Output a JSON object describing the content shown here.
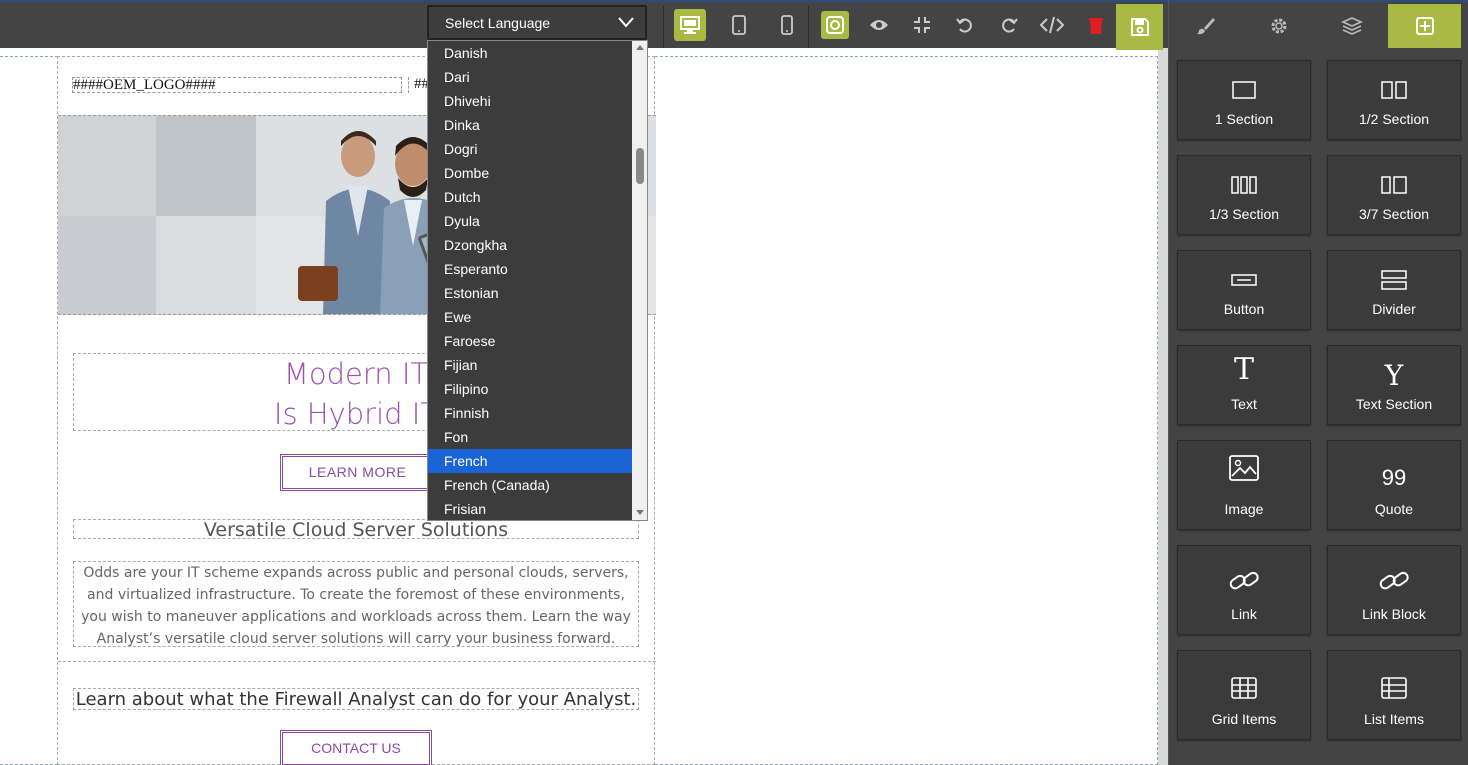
{
  "toolbar": {
    "language_select": "Select Language",
    "icons": [
      "desktop-icon",
      "tablet-icon",
      "mobile-icon",
      "outline-icon",
      "preview-icon",
      "fullscreen-exit-icon",
      "undo-icon",
      "redo-icon",
      "code-icon",
      "trash-icon",
      "save-icon"
    ]
  },
  "panel": {
    "tabs": [
      "brush-icon",
      "gear-icon",
      "layers-icon",
      "add-block-icon"
    ],
    "blocks": [
      {
        "label": "1 Section"
      },
      {
        "label": "1/2 Section"
      },
      {
        "label": "1/3 Section"
      },
      {
        "label": "3/7 Section"
      },
      {
        "label": "Button"
      },
      {
        "label": "Divider"
      },
      {
        "label": "Text"
      },
      {
        "label": "Text Section"
      },
      {
        "label": "Image"
      },
      {
        "label": "Quote"
      },
      {
        "label": "Link"
      },
      {
        "label": "Link Block"
      },
      {
        "label": "Grid Items"
      },
      {
        "label": "List Items"
      }
    ]
  },
  "email": {
    "logo": "####OEM_LOGO####",
    "logo2": "##",
    "headline_line1": "Modern IT",
    "headline_line2": "Is Hybrid IT",
    "learn_more": "LEARN MORE",
    "subhead": "Versatile Cloud Server Solutions",
    "paragraph": "Odds are your IT scheme expands across public and personal clouds, servers, and virtualized infrastructure. To create the foremost of these environments, you wish to maneuver applications and workloads across them. Learn the way Analyst’s versatile cloud server solutions will carry your business forward.",
    "learn_about": "Learn about what the Firewall Analyst can do for your Analyst.",
    "contact_us": "CONTACT US"
  },
  "dropdown": {
    "items": [
      "Danish",
      "Dari",
      "Dhivehi",
      "Dinka",
      "Dogri",
      "Dombe",
      "Dutch",
      "Dyula",
      "Dzongkha",
      "Esperanto",
      "Estonian",
      "Ewe",
      "Faroese",
      "Fijian",
      "Filipino",
      "Finnish",
      "Fon",
      "French",
      "French (Canada)",
      "Frisian"
    ],
    "selected": "French"
  },
  "colors": {
    "accent": "#a8b944",
    "brand_purple": "#9b4fae",
    "selection_blue": "#1a64d6",
    "delete_red": "#e02020"
  }
}
